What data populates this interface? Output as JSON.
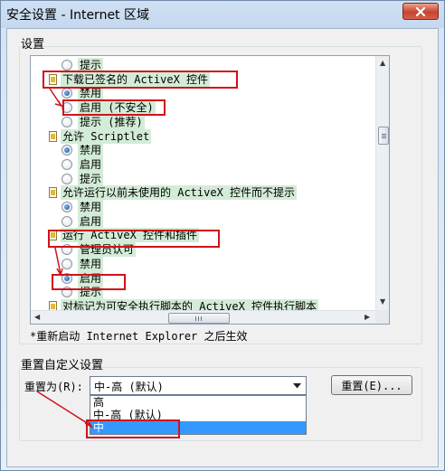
{
  "window": {
    "title": "安全设置 - Internet 区域"
  },
  "settings_group": {
    "label": "设置"
  },
  "list": {
    "rows": [
      {
        "kind": "radio",
        "checked": false,
        "text": "提示"
      },
      {
        "kind": "header",
        "text": "下载已签名的 ActiveX 控件"
      },
      {
        "kind": "radio",
        "checked": true,
        "text": "禁用"
      },
      {
        "kind": "radio",
        "checked": false,
        "text": "启用 (不安全)"
      },
      {
        "kind": "radio",
        "checked": false,
        "text": "提示 (推荐)"
      },
      {
        "kind": "header",
        "text": "允许 Scriptlet"
      },
      {
        "kind": "radio",
        "checked": true,
        "text": "禁用"
      },
      {
        "kind": "radio",
        "checked": false,
        "text": "启用"
      },
      {
        "kind": "radio",
        "checked": false,
        "text": "提示"
      },
      {
        "kind": "header",
        "text": "允许运行以前未使用的 ActiveX 控件而不提示"
      },
      {
        "kind": "radio",
        "checked": true,
        "text": "禁用"
      },
      {
        "kind": "radio",
        "checked": false,
        "text": "启用"
      },
      {
        "kind": "header",
        "text": "运行 ActiveX 控件和插件"
      },
      {
        "kind": "radio",
        "checked": false,
        "text": "管理员认可"
      },
      {
        "kind": "radio",
        "checked": false,
        "text": "禁用"
      },
      {
        "kind": "radio",
        "checked": true,
        "text": "启用"
      },
      {
        "kind": "radio",
        "checked": false,
        "text": "提示"
      },
      {
        "kind": "header",
        "text": "对标记为可安全执行脚本的 ActiveX 控件执行脚本"
      }
    ]
  },
  "note": "*重新启动 Internet Explorer 之后生效",
  "reset_group": {
    "label": "重置自定义设置",
    "reset_to_label": "重置为(R):",
    "selected": "中-高 (默认)",
    "options": [
      "高",
      "中-高 (默认)",
      "中"
    ],
    "highlighted_index": 2,
    "reset_button": "重置(E)..."
  },
  "colors": {
    "highlight_box": "#d0121b",
    "selection": "#3399ff",
    "row_bg": "#d3ecd7"
  }
}
